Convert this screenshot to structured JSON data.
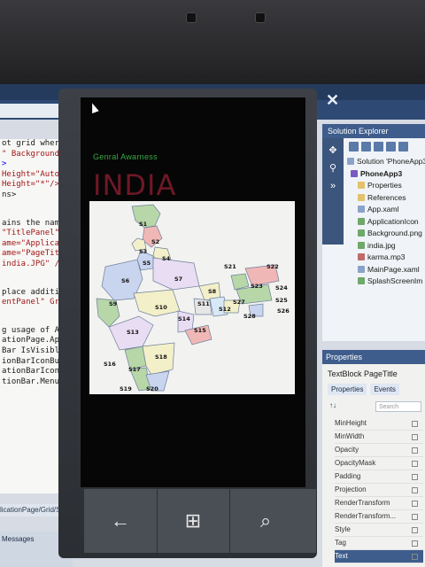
{
  "code_editor": {
    "lines": [
      "ot grid where",
      "\" Background=",
      ">",
      "Height=\"Auto\"/",
      "Height=\"*\"/>",
      "ns>",
      "",
      "ains the name",
      "\"TitlePanel\" G",
      "ame=\"Applicatio",
      "ame=\"PageTitle\"",
      "india.JPG\" />",
      "",
      "place addition",
      "entPanel\" Grid.",
      "",
      "g usage of Appl",
      "ationPage.Appli",
      "Bar IsVisible=\"",
      "ionBarIconButt",
      "ationBarIconButt",
      "tionBar.MenuIte"
    ],
    "status_path": "licationPage/Grid/Stac",
    "messages_tab": "Messages"
  },
  "solution_explorer": {
    "title": "Solution Explorer",
    "items": [
      {
        "label": "Solution 'PhoneApp3'",
        "icon": "solution-icon"
      },
      {
        "label": "PhoneApp3",
        "icon": "project-icon"
      },
      {
        "label": "Properties",
        "icon": "folder-icon"
      },
      {
        "label": "References",
        "icon": "folder-icon"
      },
      {
        "label": "App.xaml",
        "icon": "file-icon"
      },
      {
        "label": "ApplicationIcon",
        "icon": "image-icon"
      },
      {
        "label": "Background.png",
        "icon": "image-icon"
      },
      {
        "label": "india.jpg",
        "icon": "image-icon"
      },
      {
        "label": "karma.mp3",
        "icon": "audio-icon"
      },
      {
        "label": "MainPage.xaml",
        "icon": "file-icon"
      },
      {
        "label": "SplashScreenIm",
        "icon": "image-icon"
      }
    ]
  },
  "properties_panel": {
    "title": "Properties",
    "subject": "TextBlock  PageTitle",
    "tab_properties": "Properties",
    "tab_events": "Events",
    "search_placeholder": "Search",
    "sort_label": "↑↓",
    "rows": [
      "MinHeight",
      "MinWidth",
      "Opacity",
      "OpacityMask",
      "Padding",
      "Projection",
      "RenderTransform",
      "RenderTransform...",
      "Style",
      "Tag",
      "Text"
    ]
  },
  "emulator": {
    "app_subtitle": "Genral Awarness",
    "app_title": "INDIA",
    "back_symbol": "←",
    "windows_symbol": "⊞",
    "search_symbol": "⌕"
  },
  "map": {
    "states": [
      "S1",
      "S2",
      "S3",
      "S4",
      "S5",
      "S6",
      "S7",
      "S8",
      "S9",
      "S10",
      "S11",
      "S12",
      "S13",
      "S14",
      "S15",
      "S16",
      "S17",
      "S18",
      "S19",
      "S20",
      "S21",
      "S22",
      "S23",
      "S24",
      "S25",
      "S26",
      "S27",
      "S28"
    ]
  }
}
